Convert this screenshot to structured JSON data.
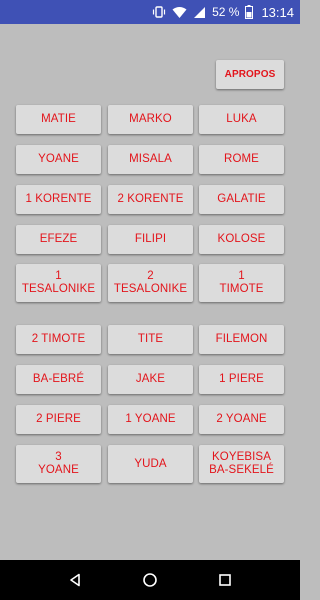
{
  "status_bar": {
    "battery": "52 %",
    "time": "13:14",
    "icons": [
      "vibrate-icon",
      "wifi-icon",
      "signal-icon",
      "battery-icon"
    ]
  },
  "colors": {
    "accent_text": "#e3141b",
    "button_bg": "#dcdcdc",
    "background": "#bdbdbd",
    "status_bar": "#3f51b5"
  },
  "apropos_label": "APROPOS",
  "books": [
    "MATIE",
    "MARKO",
    "LUKA",
    "YOANE",
    "MISALA",
    "ROME",
    "1 KORENTE",
    "2 KORENTE",
    "GALATIE",
    "EFEZE",
    "FILIPI",
    "KOLOSE",
    "1\nTESALONIKE",
    "2\nTESALONIKE",
    "1\nTIMOTE",
    "2 TIMOTE",
    "TITE",
    "FILEMON",
    "BA-EBRÉ",
    "JAKE",
    "1 PIERE",
    "2 PIERE",
    "1 YOANE",
    "2 YOANE",
    "3\nYOANE",
    "YUDA",
    "KOYEBISA\nBA-SEKELÉ"
  ],
  "nav": {
    "back": "back-icon",
    "home": "home-icon",
    "recents": "recents-icon"
  }
}
